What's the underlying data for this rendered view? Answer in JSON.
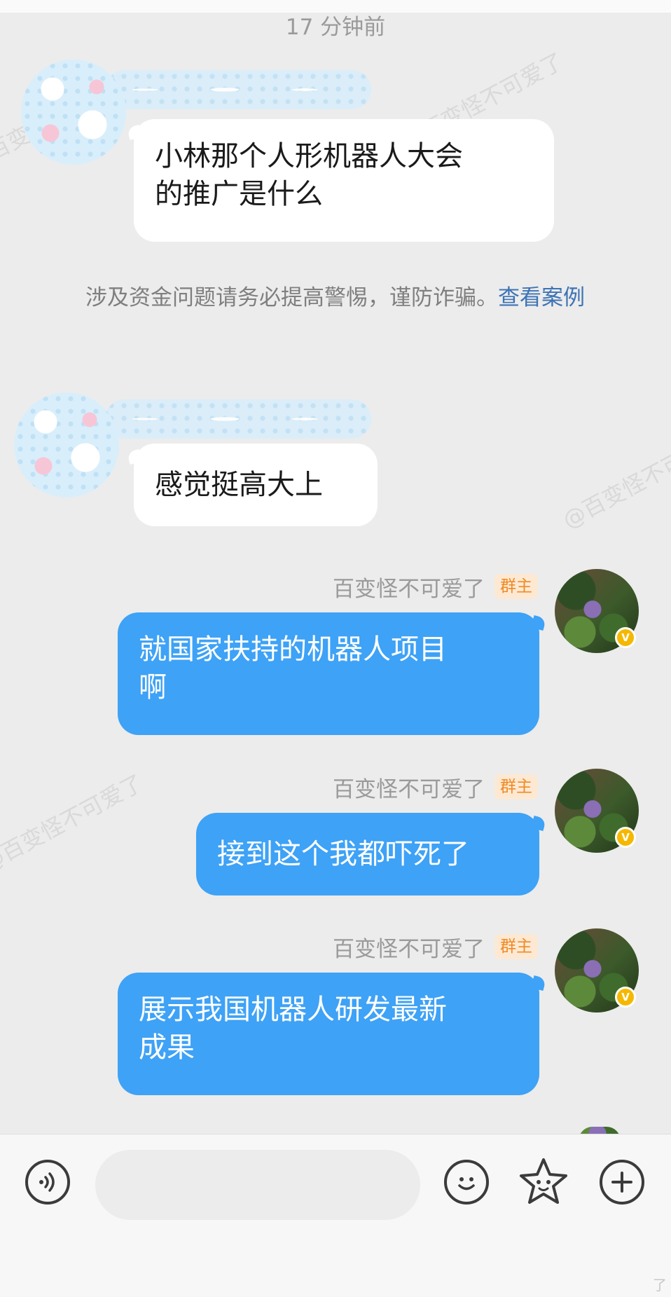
{
  "header": {
    "time_divider": "17 分钟前"
  },
  "messages": [
    {
      "side": "in",
      "text_line1": "小林那个人形机器人大会",
      "text_line2": "的推广是什么"
    },
    {
      "side": "in",
      "text_line1": "感觉挺高大上"
    },
    {
      "side": "out",
      "sender": "百变怪不可爱了",
      "role": "群主",
      "text_line1": "就国家扶持的机器人项目",
      "text_line2": "啊"
    },
    {
      "side": "out",
      "sender": "百变怪不可爱了",
      "role": "群主",
      "text_line1": "接到这个我都吓死了"
    },
    {
      "side": "out",
      "sender": "百变怪不可爱了",
      "role": "群主",
      "text_line1": "展示我国机器人研发最新",
      "text_line2": "成果"
    }
  ],
  "notice": {
    "text": "涉及资金问题请务必提高警惕，谨防诈骗。",
    "link": "查看案例"
  },
  "watermark": "@百变怪不可爱了",
  "badge": {
    "verified": "V"
  },
  "colors": {
    "outgoing_bubble": "#3ea2f6",
    "incoming_bubble": "#ffffff",
    "background": "#ececec",
    "role_badge": "#f08a24",
    "notice_link": "#3d73b5"
  },
  "input_bar": {
    "placeholder": "",
    "icons": [
      "voice-icon",
      "emoji-icon",
      "sticker-icon",
      "plus-icon"
    ]
  },
  "corner_mark": "了"
}
